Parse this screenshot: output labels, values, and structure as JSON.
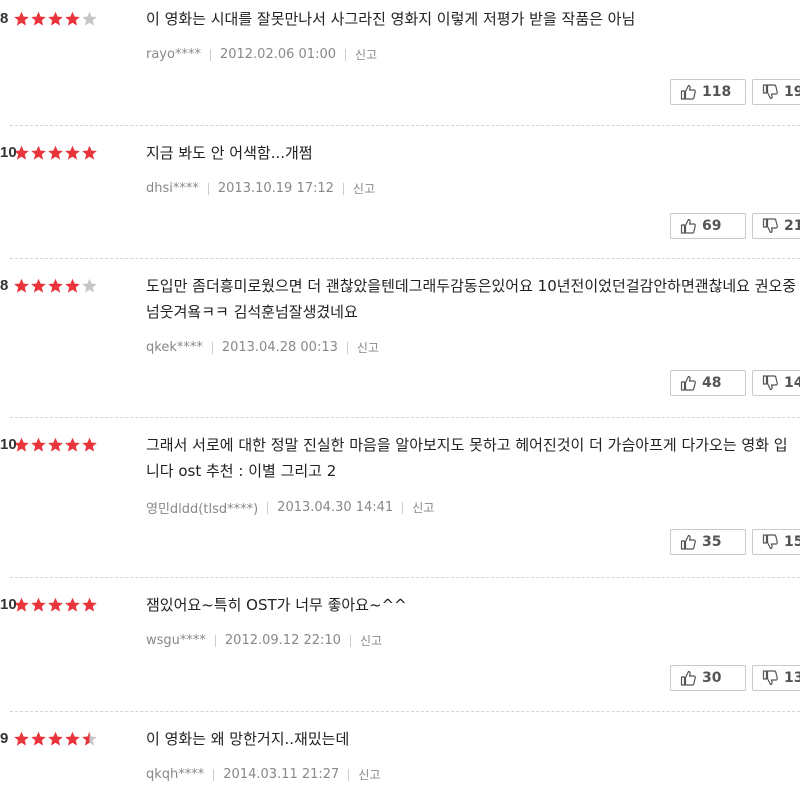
{
  "reviews": [
    {
      "stars": 4,
      "half": false,
      "score": "8",
      "text": "이 영화는 시대를 잘못만나서 사그라진 영화지 이렇게 저평가 받을 작품은 아님",
      "user": "rayo****",
      "date": "2012.02.06 01:00",
      "report": "신고",
      "likes": "118",
      "dislikes": "19"
    },
    {
      "stars": 5,
      "half": false,
      "score": "10",
      "text": "지금 봐도 안 어색함...개쩜",
      "user": "dhsi****",
      "date": "2013.10.19 17:12",
      "report": "신고",
      "likes": "69",
      "dislikes": "21"
    },
    {
      "stars": 4,
      "half": false,
      "score": "8",
      "text": "도입만 좀더흥미로웠으면 더 괜찮았을텐데그래두감동은있어요 10년전이었던걸감안하면괜찮네요 권오중넘웃겨욬ㅋㅋ 김석훈넘잘생겼네요",
      "user": "qkek****",
      "date": "2013.04.28 00:13",
      "report": "신고",
      "likes": "48",
      "dislikes": "14"
    },
    {
      "stars": 5,
      "half": false,
      "score": "10",
      "text": "그래서 서로에 대한 정말 진실한 마음을 알아보지도 못하고 헤어진것이 더 가슴아프게 다가오는 영화 입니다 ost 추천 : 이별 그리고 2",
      "user": "영민dldd(tlsd****)",
      "date": "2013.04.30 14:41",
      "report": "신고",
      "likes": "35",
      "dislikes": "15"
    },
    {
      "stars": 5,
      "half": false,
      "score": "10",
      "text": "잼있어요~특히 OST가 너무 좋아요~^^",
      "user": "wsgu****",
      "date": "2012.09.12 22:10",
      "report": "신고",
      "likes": "30",
      "dislikes": "13"
    },
    {
      "stars": 4,
      "half": true,
      "score": "9",
      "text": "이 영화는 왜 망한거지..재밌는데",
      "user": "qkqh****",
      "date": "2014.03.11 21:27",
      "report": "신고",
      "likes": "",
      "dislikes": ""
    }
  ],
  "colors": {
    "star_on": "#e8343a",
    "star_off": "#c7c7c7"
  },
  "icons": {
    "like": "thumbs-up-icon",
    "dislike": "thumbs-down-icon"
  }
}
